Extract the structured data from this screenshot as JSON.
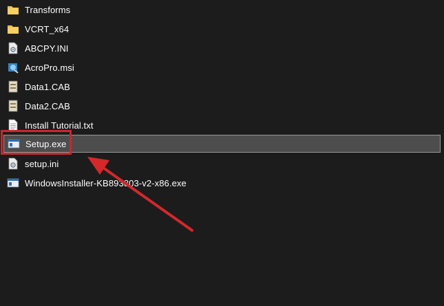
{
  "files": [
    {
      "name": "Transforms",
      "icon": "folder-icon"
    },
    {
      "name": "VCRT_x64",
      "icon": "folder-icon"
    },
    {
      "name": "ABCPY.INI",
      "icon": "settings-file-icon"
    },
    {
      "name": "AcroPro.msi",
      "icon": "installer-package-icon"
    },
    {
      "name": "Data1.CAB",
      "icon": "cabinet-file-icon"
    },
    {
      "name": "Data2.CAB",
      "icon": "cabinet-file-icon"
    },
    {
      "name": "Install Tutorial.txt",
      "icon": "text-file-icon"
    },
    {
      "name": "Setup.exe",
      "icon": "application-icon",
      "selected": true
    },
    {
      "name": "setup.ini",
      "icon": "settings-file-icon"
    },
    {
      "name": "WindowsInstaller-KB893803-v2-x86.exe",
      "icon": "application-icon"
    }
  ],
  "annotation": {
    "highlight_color": "#c8282d",
    "arrow_color": "#d4282b"
  },
  "colors": {
    "background": "#1c1c1c",
    "selected_row": "#4d4d4d",
    "folder": "#f2c14e"
  }
}
